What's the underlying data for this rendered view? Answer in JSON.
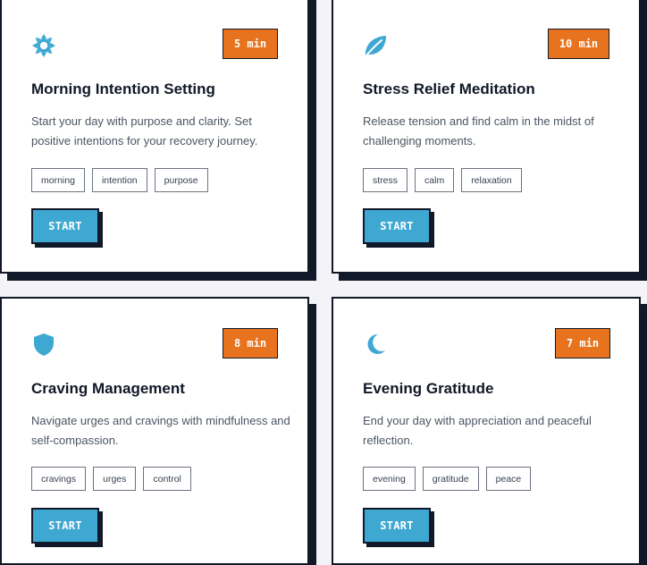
{
  "colors": {
    "accent_orange": "#e8731e",
    "icon_blue": "#3fa8d2",
    "border_dark": "#111827"
  },
  "cards": [
    {
      "icon": "sun-icon",
      "duration": "5 min",
      "title": "Morning Intention Setting",
      "description": "Start your day with purpose and clarity. Set positive intentions for your recovery journey.",
      "tags": [
        "morning",
        "intention",
        "purpose"
      ],
      "button": "START"
    },
    {
      "icon": "leaf-icon",
      "duration": "10 min",
      "title": "Stress Relief Meditation",
      "description": "Release tension and find calm in the midst of challenging moments.",
      "tags": [
        "stress",
        "calm",
        "relaxation"
      ],
      "button": "START"
    },
    {
      "icon": "shield-icon",
      "duration": "8 min",
      "title": "Craving Management",
      "description": "Navigate urges and cravings with mindfulness and self-compassion.",
      "tags": [
        "cravings",
        "urges",
        "control"
      ],
      "button": "START"
    },
    {
      "icon": "moon-icon",
      "duration": "7 min",
      "title": "Evening Gratitude",
      "description": "End your day with appreciation and peaceful reflection.",
      "tags": [
        "evening",
        "gratitude",
        "peace"
      ],
      "button": "START"
    }
  ]
}
